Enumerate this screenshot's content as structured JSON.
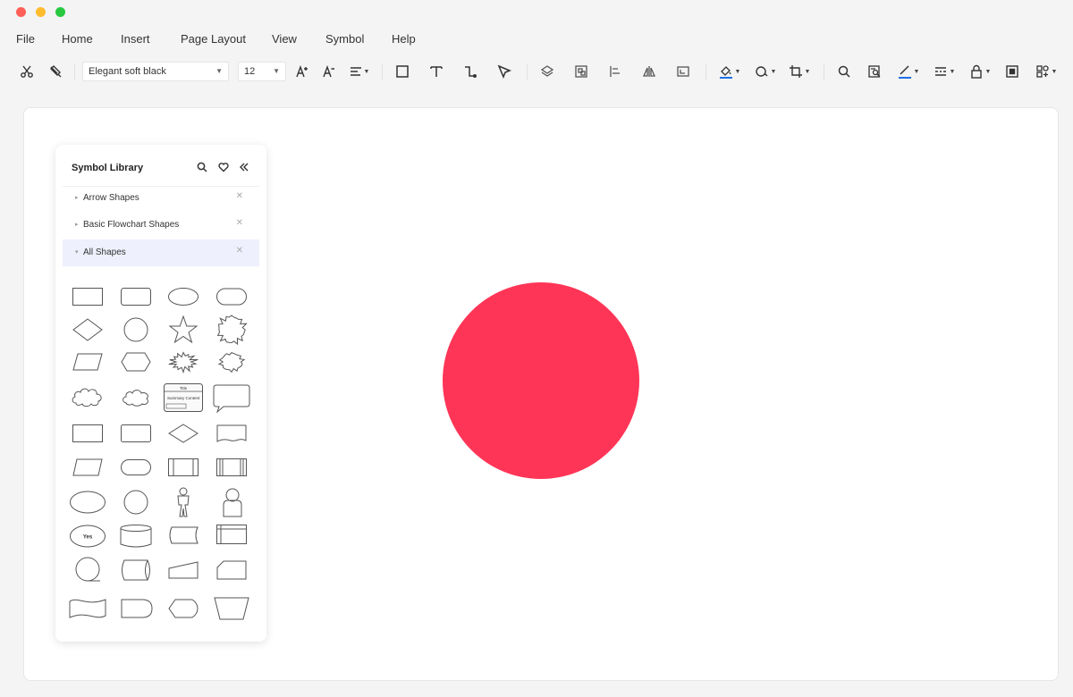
{
  "menu": [
    "File",
    "Home",
    "Insert",
    "Page Layout",
    "View",
    "Symbol",
    "Help"
  ],
  "toolbar": {
    "font_family": "Elegant soft black",
    "font_size": "12"
  },
  "colors": {
    "circle_fill": "#ff3557",
    "accent": "#1e6fe8",
    "active_category_bg": "#eef0fd"
  },
  "symbol_library": {
    "title": "Symbol Library",
    "categories": [
      {
        "label": "Arrow Shapes",
        "expanded": false
      },
      {
        "label": "Basic Flowchart Shapes",
        "expanded": false
      },
      {
        "label": "All Shapes",
        "expanded": true
      }
    ],
    "shape_texts": {
      "yes": "Yes",
      "title": "Title",
      "subtitle": "Summary Content"
    }
  }
}
